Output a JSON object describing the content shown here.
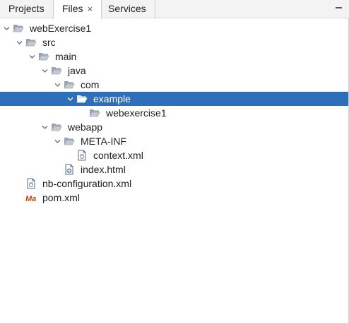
{
  "tabs": [
    {
      "label": "Projects"
    },
    {
      "label": "Files",
      "close": "×"
    },
    {
      "label": "Services"
    }
  ],
  "tree": [
    {
      "label": "webExercise1",
      "icon": "folder-open-icon",
      "expanded": true
    },
    {
      "label": "src",
      "icon": "folder-open-icon",
      "expanded": true
    },
    {
      "label": "main",
      "icon": "folder-open-icon",
      "expanded": true
    },
    {
      "label": "java",
      "icon": "folder-open-icon",
      "expanded": true
    },
    {
      "label": "com",
      "icon": "folder-open-icon",
      "expanded": true
    },
    {
      "label": "example",
      "icon": "folder-open-icon",
      "expanded": true,
      "selected": true
    },
    {
      "label": "webexercise1",
      "icon": "folder-open-icon"
    },
    {
      "label": "webapp",
      "icon": "folder-open-icon",
      "expanded": true
    },
    {
      "label": "META-INF",
      "icon": "folder-open-icon",
      "expanded": true
    },
    {
      "label": "context.xml",
      "icon": "xml-file-icon"
    },
    {
      "label": "index.html",
      "icon": "html-file-icon"
    },
    {
      "label": "nb-configuration.xml",
      "icon": "xml-file-icon"
    },
    {
      "label": "pom.xml",
      "icon": "maven-file-icon"
    }
  ],
  "colors": {
    "selection": "#2f6fb9",
    "folder": "#9aa4ae"
  }
}
